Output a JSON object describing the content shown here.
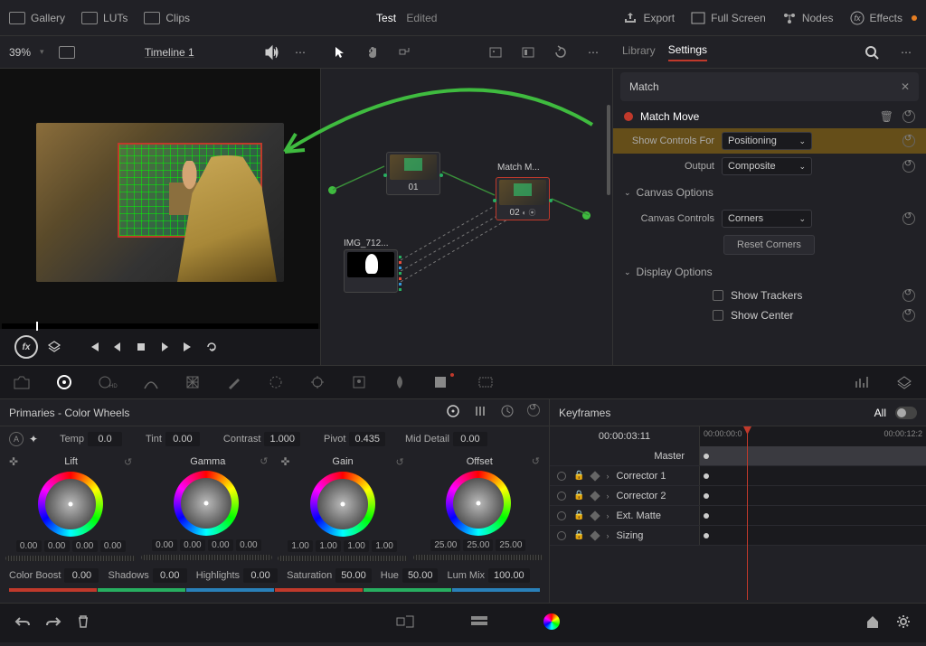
{
  "topbar": {
    "gallery": "Gallery",
    "luts": "LUTs",
    "clips": "Clips",
    "project": "Test",
    "edited": "Edited",
    "export": "Export",
    "fullscreen": "Full Screen",
    "nodes": "Nodes",
    "effects": "Effects"
  },
  "row2": {
    "zoom": "39%",
    "timeline": "Timeline 1",
    "tabs": {
      "library": "Library",
      "settings": "Settings"
    }
  },
  "inspector": {
    "search": "Match",
    "title": "Match Move",
    "showControlsFor": {
      "label": "Show Controls For",
      "value": "Positioning"
    },
    "output": {
      "label": "Output",
      "value": "Composite"
    },
    "canvasOptions": "Canvas Options",
    "canvasControls": {
      "label": "Canvas Controls",
      "value": "Corners"
    },
    "resetCorners": "Reset Corners",
    "displayOptions": "Display Options",
    "showTrackers": "Show Trackers",
    "showCenter": "Show Center"
  },
  "nodes": {
    "n01": "01",
    "matchM": "Match M...",
    "n02": "02",
    "img": "IMG_712..."
  },
  "primaries": {
    "title": "Primaries - Color Wheels",
    "adjustments": {
      "temp": {
        "label": "Temp",
        "value": "0.0"
      },
      "tint": {
        "label": "Tint",
        "value": "0.00"
      },
      "contrast": {
        "label": "Contrast",
        "value": "1.000"
      },
      "pivot": {
        "label": "Pivot",
        "value": "0.435"
      },
      "midDetail": {
        "label": "Mid Detail",
        "value": "0.00"
      }
    },
    "wheels": {
      "lift": {
        "name": "Lift",
        "vals": [
          "0.00",
          "0.00",
          "0.00",
          "0.00"
        ]
      },
      "gamma": {
        "name": "Gamma",
        "vals": [
          "0.00",
          "0.00",
          "0.00",
          "0.00"
        ]
      },
      "gain": {
        "name": "Gain",
        "vals": [
          "1.00",
          "1.00",
          "1.00",
          "1.00"
        ]
      },
      "offset": {
        "name": "Offset",
        "vals": [
          "25.00",
          "25.00",
          "25.00"
        ]
      }
    },
    "row2": {
      "colorBoost": {
        "label": "Color Boost",
        "value": "0.00"
      },
      "shadows": {
        "label": "Shadows",
        "value": "0.00"
      },
      "highlights": {
        "label": "Highlights",
        "value": "0.00"
      },
      "saturation": {
        "label": "Saturation",
        "value": "50.00"
      },
      "hue": {
        "label": "Hue",
        "value": "50.00"
      },
      "lumMix": {
        "label": "Lum Mix",
        "value": "100.00"
      }
    }
  },
  "keyframes": {
    "title": "Keyframes",
    "all": "All",
    "timecode": "00:00:03:11",
    "tc_start": "00:00:00:0",
    "tc_end": "00:00:12:2",
    "tracks": {
      "master": "Master",
      "c1": "Corrector 1",
      "c2": "Corrector 2",
      "ext": "Ext. Matte",
      "sizing": "Sizing"
    }
  }
}
